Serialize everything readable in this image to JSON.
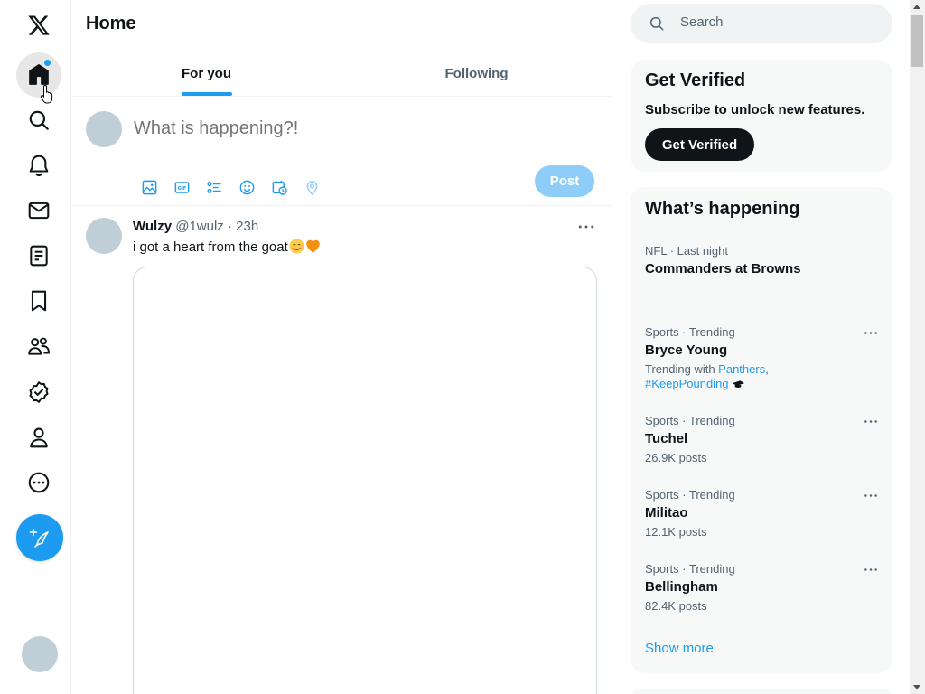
{
  "colors": {
    "accent": "#1d9bf0",
    "text_primary": "#0f1419",
    "text_secondary": "#536471",
    "post_disabled": "#8ecdf8",
    "heart_orange": "#f4900c",
    "emoji_face": "#ffcc4d"
  },
  "nav": {
    "items": [
      {
        "name": "x-logo-icon"
      },
      {
        "name": "home-icon",
        "active": true,
        "notification_dot": true
      },
      {
        "name": "explore-icon"
      },
      {
        "name": "notifications-icon"
      },
      {
        "name": "messages-icon"
      },
      {
        "name": "lists-icon"
      },
      {
        "name": "bookmarks-icon"
      },
      {
        "name": "communities-icon"
      },
      {
        "name": "verified-icon"
      },
      {
        "name": "profile-icon"
      },
      {
        "name": "more-icon"
      }
    ],
    "compose_icon": "feather-plus-icon"
  },
  "main": {
    "title": "Home",
    "tabs": [
      {
        "label": "For you",
        "active": true
      },
      {
        "label": "Following",
        "active": false
      }
    ],
    "composer": {
      "placeholder": "What is happening?!",
      "tools": [
        "image-icon",
        "gif-icon",
        "poll-icon",
        "emoji-icon",
        "schedule-icon",
        "location-icon"
      ],
      "post_label": "Post"
    },
    "tweet": {
      "name": "Wulzy",
      "handle": "@1wulz",
      "separator": "·",
      "time": "23h",
      "text": "i got a heart from the goat",
      "emojis": [
        "smiling-face-emoji",
        "orange-heart-emoji"
      ]
    }
  },
  "sidebar": {
    "search_placeholder": "Search",
    "verified": {
      "title": "Get Verified",
      "subtitle": "Subscribe to unlock new features.",
      "button": "Get Verified"
    },
    "trends": {
      "title": "What’s happening",
      "items": [
        {
          "meta": "NFL · Last night",
          "title": "Commanders at Browns",
          "sub": "",
          "has_more": false
        },
        {
          "meta": "Sports · Trending",
          "title": "Bryce Young",
          "sub_prefix": "Trending with ",
          "sub_link1": "Panthers",
          "sub_comma": ",",
          "sub_link2": "#KeepPounding",
          "has_more": true
        },
        {
          "meta": "Sports · Trending",
          "title": "Tuchel",
          "sub": "26.9K posts",
          "has_more": true
        },
        {
          "meta": "Sports · Trending",
          "title": "Militao",
          "sub": "12.1K posts",
          "has_more": true
        },
        {
          "meta": "Sports · Trending",
          "title": "Bellingham",
          "sub": "82.4K posts",
          "has_more": true
        }
      ],
      "show_more": "Show more"
    }
  }
}
